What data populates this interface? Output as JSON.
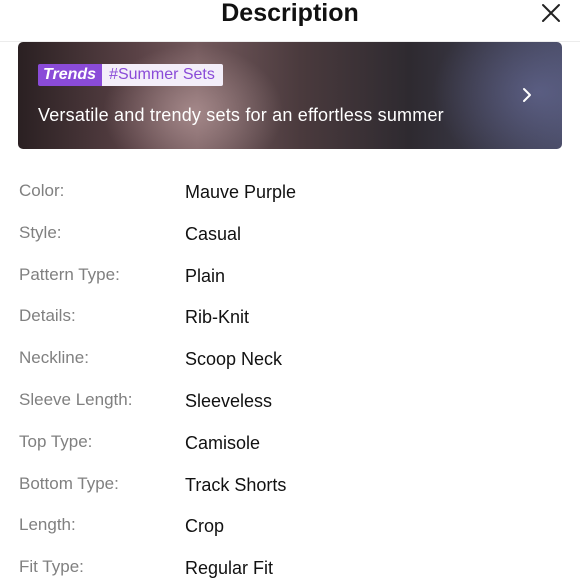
{
  "header": {
    "title": "Description"
  },
  "banner": {
    "badge_logo": "Trends",
    "badge_tag": "#Summer Sets",
    "text": "Versatile and trendy sets for an effortless summer"
  },
  "details": [
    {
      "label": "Color:",
      "value": "Mauve Purple"
    },
    {
      "label": "Style:",
      "value": "Casual"
    },
    {
      "label": "Pattern Type:",
      "value": "Plain"
    },
    {
      "label": "Details:",
      "value": "Rib-Knit"
    },
    {
      "label": "Neckline:",
      "value": "Scoop Neck"
    },
    {
      "label": "Sleeve Length:",
      "value": "Sleeveless"
    },
    {
      "label": "Top Type:",
      "value": "Camisole"
    },
    {
      "label": "Bottom Type:",
      "value": "Track Shorts"
    },
    {
      "label": "Length:",
      "value": "Crop"
    },
    {
      "label": "Fit Type:",
      "value": "Regular Fit"
    }
  ],
  "colors": {
    "trends_accent": "#8a4bd8",
    "label_gray": "#808080",
    "value_black": "#111111"
  }
}
